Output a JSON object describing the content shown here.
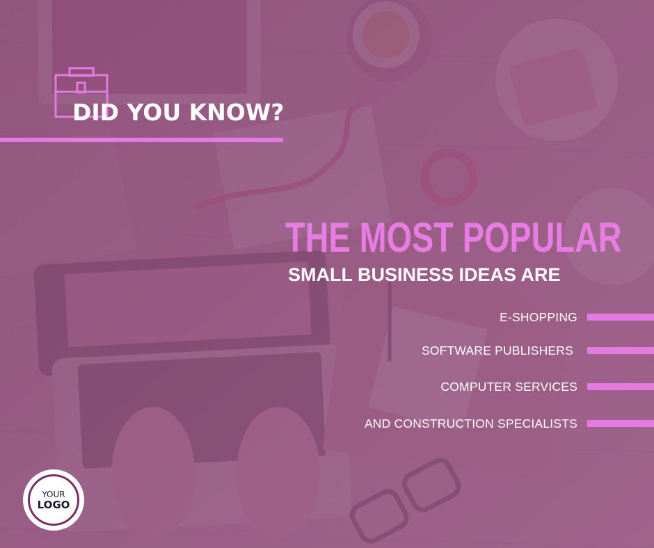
{
  "heading": {
    "did_you_know": "DID YOU KNOW?",
    "title_line1": "THE MOST POPULAR",
    "title_line2": "SMALL BUSINESS IDEAS ARE"
  },
  "ideas": [
    {
      "label": "E-SHOPPING"
    },
    {
      "label": "SOFTWARE PUBLISHERS"
    },
    {
      "label": "COMPUTER SERVICES"
    },
    {
      "label": "AND CONSTRUCTION SPECIALISTS"
    }
  ],
  "logo": {
    "line1": "YOUR",
    "line2": "LOGO"
  },
  "icons": {
    "badge": "briefcase-icon"
  },
  "colors": {
    "accent_pink": "#e47adf",
    "headline_pink": "#e77de3",
    "overlay_plum": "#7a3f66",
    "text_white": "#ffffff",
    "logo_ring": "#7a2f62",
    "logo_text": "#1d1a2e"
  }
}
